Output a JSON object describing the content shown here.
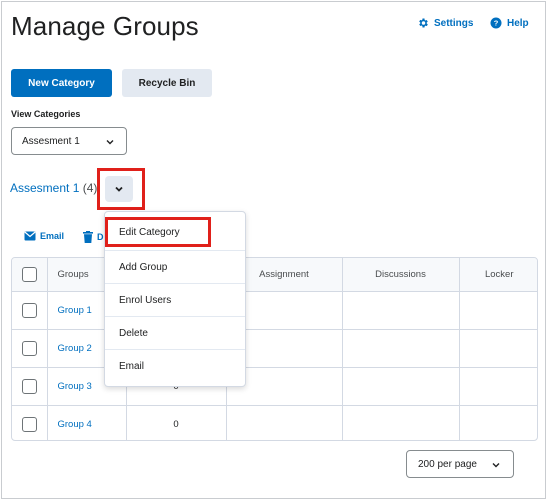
{
  "page": {
    "title": "Manage Groups"
  },
  "header_links": {
    "settings": "Settings",
    "help": "Help"
  },
  "buttons": {
    "new_category": "New Category",
    "recycle_bin": "Recycle Bin"
  },
  "view_categories": {
    "label": "View Categories",
    "selected": "Assesment 1"
  },
  "category": {
    "name": "Assesment 1",
    "count": "(4)"
  },
  "toolbar": {
    "email": "Email",
    "delete": "D"
  },
  "table": {
    "headers": [
      "Groups",
      "Assignment",
      "Discussions",
      "Locker"
    ],
    "rows": [
      {
        "name": "Group 1",
        "members": ""
      },
      {
        "name": "Group 2",
        "members": ""
      },
      {
        "name": "Group 3",
        "members": "0"
      },
      {
        "name": "Group 4",
        "members": "0"
      }
    ]
  },
  "context_menu": {
    "items": [
      "Edit Category",
      "Add Group",
      "Enrol Users",
      "Delete",
      "Email"
    ]
  },
  "pagination": {
    "per_page": "200 per page"
  },
  "colors": {
    "link": "#006fbf",
    "primary_button": "#006fbf",
    "highlight": "#e0201a",
    "secondary_button": "#e3e9f1"
  }
}
